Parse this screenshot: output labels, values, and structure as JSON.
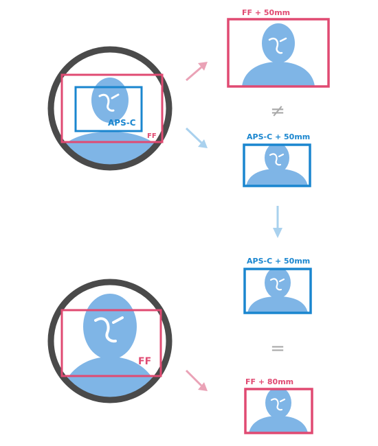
{
  "labels": {
    "ff_50mm": "FF + 50mm",
    "apsc_50mm_top": "APS-C + 50mm",
    "apsc_50mm_bottom": "APS-C + 50mm",
    "ff_80mm": "FF + 80mm",
    "apsc_sensor": "APS-C",
    "ff_sensor_top": "FF",
    "ff_sensor_bottom": "FF",
    "not_equal": "≠",
    "equal": "="
  },
  "colors": {
    "pink": "#e04a72",
    "blue": "#1a86cf",
    "face": "#7fb5e6",
    "lens_ring": "#4a4a4a",
    "arrow_pink": "#eaa2b6",
    "arrow_blue": "#a9d1ee",
    "symbol_gray": "#aaaaaa"
  }
}
